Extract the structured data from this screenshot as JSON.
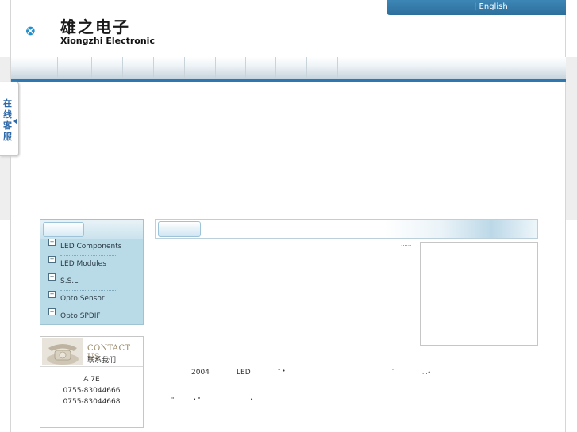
{
  "header": {
    "logo_cn": "雄之电子",
    "logo_en": "Xiongzhi Electronic",
    "lang_label": "| English"
  },
  "nav": {
    "items": [
      "",
      "",
      "",
      "",
      "",
      "",
      "",
      "",
      "",
      "",
      ""
    ]
  },
  "kefu": {
    "label": "在线客服"
  },
  "categories": {
    "items": [
      {
        "label": "LED Components"
      },
      {
        "label": "LED Modules"
      },
      {
        "label": "S.S.L"
      },
      {
        "label": "Opto Sensor"
      },
      {
        "label": "Opto SPDIF"
      }
    ]
  },
  "contact": {
    "title_en": "CONTACT US",
    "title_cn": "联系我们",
    "address": "A 7E",
    "phone1": "0755-83044666",
    "phone2": "0755-83044668"
  },
  "main": {
    "more_label": "......",
    "year": "2004",
    "led": "LED"
  },
  "colors": {
    "accent": "#2d78b0",
    "category_bg": "#b9dbe8",
    "lang_bar": "#3c86b6"
  }
}
